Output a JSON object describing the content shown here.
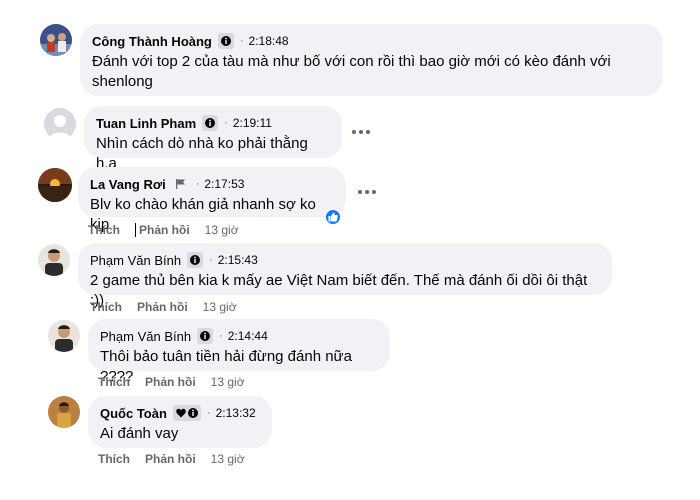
{
  "comments": [
    {
      "author": "Công Thành Hoàng",
      "badge_icon": "info-icon",
      "time": "2:18:48",
      "text": "Đánh với top 2 của tàu mà như bố với con rồi thì bao giờ mới có kèo đánh với shenlong"
    },
    {
      "author": "Tuan Linh Pham",
      "badge_icon": "info-icon",
      "time": "2:19:11",
      "text": "Nhìn cách dò nhà ko phải thằng h.a"
    },
    {
      "author": "La Vang Rơi",
      "badge_icon": "flag-icon",
      "time": "2:17:53",
      "text": "Blv ko chào khán giả nhanh sợ ko kịp",
      "reaction": "like",
      "actions": {
        "like": "Thích",
        "reply": "Phản hồi",
        "ago": "13 giờ"
      }
    },
    {
      "author": "Phạm Văn Bính",
      "badge_icon": "info-icon",
      "time": "2:15:43",
      "text": "2 game thủ bên kia k mấy ae Việt Nam biết đến. Thế mà đánh ối dồi ôi thật :))",
      "actions": {
        "like": "Thích",
        "reply": "Phản hồi",
        "ago": "13 giờ"
      }
    },
    {
      "author": "Phạm Văn Bính",
      "badge_icon": "info-icon",
      "time": "2:14:44",
      "text": "Thôi bảo tuân tiền hải đừng đánh nữa ????",
      "actions": {
        "like": "Thích",
        "reply": "Phản hồi",
        "ago": "13 giờ"
      }
    },
    {
      "author": "Quốc Toàn",
      "badge_icon": "heart-info-icon",
      "time": "2:13:32",
      "text": "Ai đánh vay",
      "actions": {
        "like": "Thích",
        "reply": "Phản hồi",
        "ago": "13 giờ"
      }
    }
  ],
  "separator_dot": "·",
  "colors": {
    "bubble": "#f0f2f5",
    "text": "#050505",
    "muted": "#65676b",
    "like_blue": "#1877f2"
  }
}
